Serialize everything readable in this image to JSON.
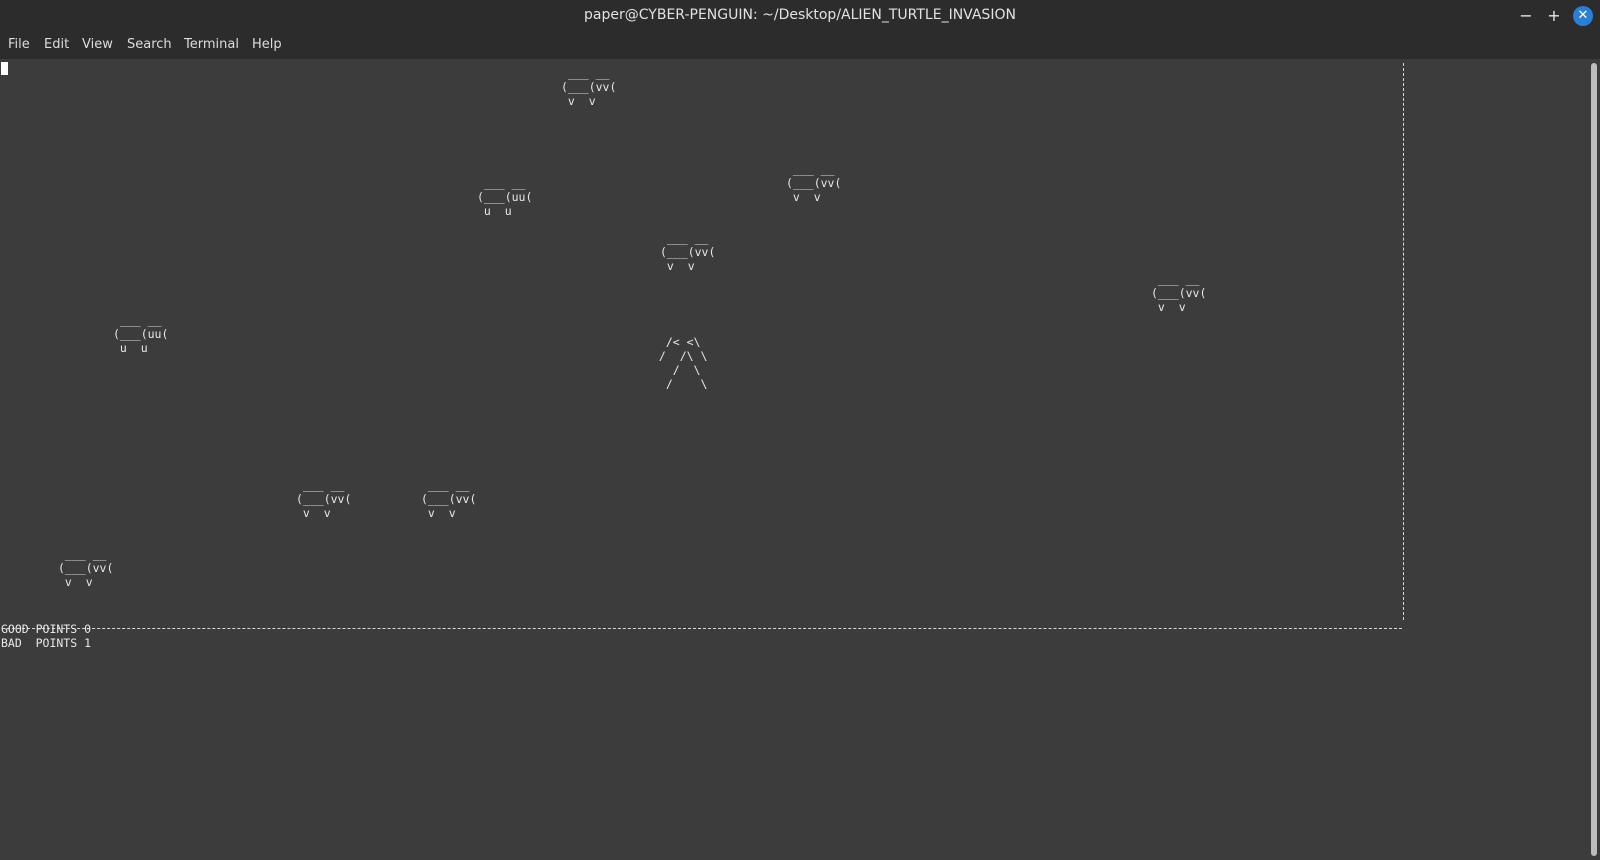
{
  "window": {
    "title": "paper@CYBER-PENGUIN: ~/Desktop/ALIEN_TURTLE_INVASION",
    "minimize_glyph": "−",
    "maximize_glyph": "+",
    "close_glyph": "✕"
  },
  "menu": {
    "items": [
      "File",
      "Edit",
      "View",
      "Search",
      "Terminal",
      "Help"
    ]
  },
  "game": {
    "turtles": [
      {
        "art": " ___ __\n(___(vv(\n v  v",
        "kind": "normal"
      },
      {
        "art": " ___ __\n(___(uu(\n u  u",
        "kind": "legs-up"
      },
      {
        "art": " ___ __\n(___(vv(\n v  v",
        "kind": "normal"
      },
      {
        "art": " ___ __\n(___(vv(\n v  v",
        "kind": "normal"
      },
      {
        "art": " ___ __\n(___(vv(\n v  v",
        "kind": "normal"
      },
      {
        "art": " ___ __\n(___(uu(\n u  u",
        "kind": "legs-up"
      },
      {
        "art": " ___ __\n(___(vv(\n v  v",
        "kind": "normal"
      },
      {
        "art": " ___ __\n(___(vv(\n v  v",
        "kind": "normal"
      },
      {
        "art": " ___ __\n(___(vv(\n v  v",
        "kind": "normal"
      }
    ],
    "player": {
      "art": "  /< <\\\n /  /\\ \\\n   /  \\\n  /    \\"
    },
    "score": {
      "good_line": "GOOD POINTS 0",
      "bad_line": "BAD  POINTS 1"
    }
  },
  "colors": {
    "terminal_bg": "#3c3c3c",
    "titlebar_bg": "#2c2c2c",
    "text": "#e8e8e8",
    "close_button": "#2a7fd4"
  }
}
